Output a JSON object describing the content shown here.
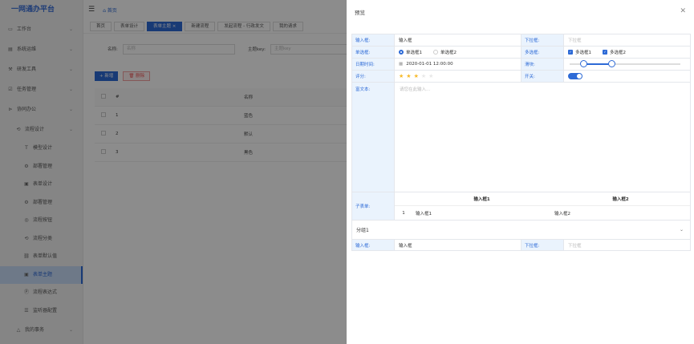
{
  "sidebar": {
    "logo": "一网通办平台",
    "items": [
      {
        "label": "工作台",
        "icon": "monitor-icon",
        "level": 1,
        "arrow": true
      },
      {
        "label": "系统运维",
        "icon": "server-icon",
        "level": 1,
        "arrow": true
      },
      {
        "label": "研发工具",
        "icon": "tool-icon",
        "level": 1,
        "arrow": true
      },
      {
        "label": "任务管理",
        "icon": "task-icon",
        "level": 1,
        "arrow": true
      },
      {
        "label": "协同办公",
        "icon": "collab-icon",
        "level": 1,
        "arrow": true
      },
      {
        "label": "流程设计",
        "icon": "flow-icon",
        "level": 2,
        "arrow": true
      },
      {
        "label": "模型设计",
        "icon": "model-icon",
        "level": 3
      },
      {
        "label": "部署管理",
        "icon": "deploy-icon",
        "level": 3
      },
      {
        "label": "表单设计",
        "icon": "form-icon",
        "level": 3
      },
      {
        "label": "部署管理",
        "icon": "deploy2-icon",
        "level": 3
      },
      {
        "label": "流程按钮",
        "icon": "button-icon",
        "level": 3
      },
      {
        "label": "流程分类",
        "icon": "category-icon",
        "level": 3
      },
      {
        "label": "表单默认值",
        "icon": "link-icon",
        "level": 3
      },
      {
        "label": "表单主题",
        "icon": "theme-icon",
        "level": 3,
        "active": true
      },
      {
        "label": "流程表达式",
        "icon": "expression-icon",
        "level": 3
      },
      {
        "label": "监听器配置",
        "icon": "listener-icon",
        "level": 3
      },
      {
        "label": "我的事务",
        "icon": "bell-icon",
        "level": 2,
        "arrow": true
      }
    ]
  },
  "topbar": {
    "breadcrumb": "首页"
  },
  "tabs": [
    {
      "label": "首页"
    },
    {
      "label": "表单设计"
    },
    {
      "label": "表单主题 ×",
      "active": true
    },
    {
      "label": "新建流程"
    },
    {
      "label": "发起流程 - 行政发文"
    },
    {
      "label": "我的请求"
    }
  ],
  "filters": {
    "name_label": "名称:",
    "name_placeholder": "名称",
    "key_label": "主题key:",
    "key_placeholder": "主题key"
  },
  "actions": {
    "add": "+ 新增",
    "delete": "删除",
    "delete_icon": "trash-icon"
  },
  "table": {
    "headers": {
      "num": "#",
      "name": "名称"
    },
    "rows": [
      {
        "num": "1",
        "name": "蓝色"
      },
      {
        "num": "2",
        "name": "默认"
      },
      {
        "num": "3",
        "name": "黑色"
      }
    ]
  },
  "drawer": {
    "title": "预览",
    "close_icon": "close-icon",
    "form": {
      "input_label": "输入框:",
      "input_value": "输入框",
      "select_label": "下拉框:",
      "select_placeholder": "下拉框",
      "radio_label": "单选框:",
      "radio1": "单选框1",
      "radio2": "单选框2",
      "checkbox_label": "多选框:",
      "check1": "多选框1",
      "check2": "多选框2",
      "date_label": "日期时间:",
      "date_value": "2020-01-01 12:00:00",
      "slider_label": "滑块:",
      "slider_from": 0.12,
      "slider_to": 0.38,
      "rate_label": "评分:",
      "rate_value": 3,
      "rate_max": 5,
      "switch_label": "开关:",
      "switch_on": true,
      "richtext_label": "富文本:",
      "richtext_placeholder": "请您在此输入...",
      "subform_label": "子表单:",
      "subform_headers": {
        "c1": "输入框1",
        "c2": "输入框2"
      },
      "subform_rows": [
        {
          "idx": "1",
          "c1": "输入框1",
          "c2": "输入框2"
        }
      ],
      "group_title": "分组1",
      "g_input_label": "输入框:",
      "g_input_value": "输入框",
      "g_select_label": "下拉框:",
      "g_select_placeholder": "下拉框"
    }
  },
  "colors": {
    "primary": "#2d6ad6",
    "label_bg": "#eaf3fd",
    "star": "#f7ba2a"
  }
}
